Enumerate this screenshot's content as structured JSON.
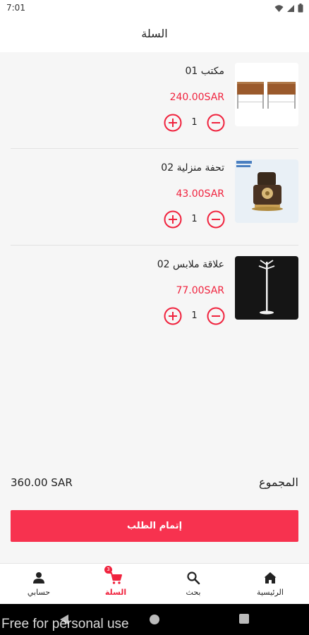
{
  "status": {
    "time": "7:01"
  },
  "header": {
    "title": "السلة"
  },
  "cart": {
    "items": [
      {
        "name": "مكتب 01",
        "price": "240.00SAR",
        "qty": "1"
      },
      {
        "name": "تحفة منزلية 02",
        "price": "43.00SAR",
        "qty": "1"
      },
      {
        "name": "علاقة ملابس 02",
        "price": "77.00SAR",
        "qty": "1"
      }
    ]
  },
  "summary": {
    "label": "المجموع",
    "amount": "360.00 SAR"
  },
  "checkout": {
    "label": "إتمام الطلب"
  },
  "nav": {
    "items": [
      {
        "label": "الرئيسية",
        "icon": "home-icon"
      },
      {
        "label": "بحث",
        "icon": "search-icon"
      },
      {
        "label": "السلة",
        "icon": "cart-icon",
        "badge": "3",
        "active": true
      },
      {
        "label": "حسابي",
        "icon": "person-icon"
      }
    ]
  },
  "watermark": "Free for personal use",
  "colors": {
    "accent": "#f0233e",
    "button": "#f7324f",
    "background": "#f6f6f6"
  }
}
